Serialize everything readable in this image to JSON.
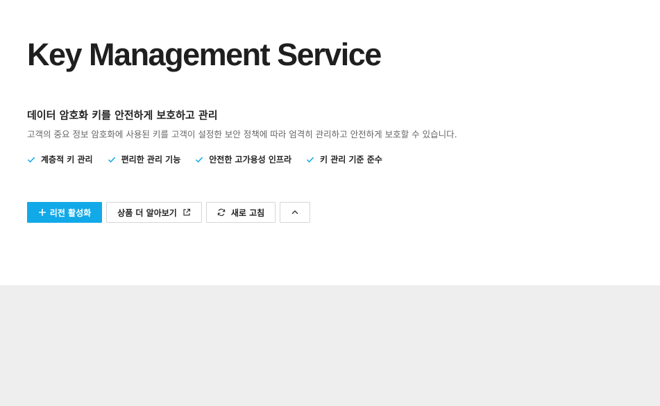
{
  "header": {
    "title": "Key Management Service"
  },
  "intro": {
    "subtitle": "데이터 암호화 키를 안전하게 보호하고 관리",
    "description": "고객의 중요 정보 암호화에 사용된 키를 고객이 설정한 보안 정책에 따라 엄격히 관리하고 안전하게 보호할 수 있습니다."
  },
  "features": [
    {
      "label": "계층적 키 관리",
      "icon": "check-icon"
    },
    {
      "label": "편리한 관리 기능",
      "icon": "check-icon"
    },
    {
      "label": "안전한 고가용성 인프라",
      "icon": "check-icon"
    },
    {
      "label": "키 관리 기준 준수",
      "icon": "check-icon"
    }
  ],
  "actions": {
    "activate_label": "리전 활성화",
    "learn_more_label": "상품 더 알아보기",
    "refresh_label": "새로 고침"
  },
  "colors": {
    "accent": "#12a9e8",
    "page_background": "#eeeeee",
    "hero_background": "#ffffff",
    "check": "#12a9e8"
  }
}
